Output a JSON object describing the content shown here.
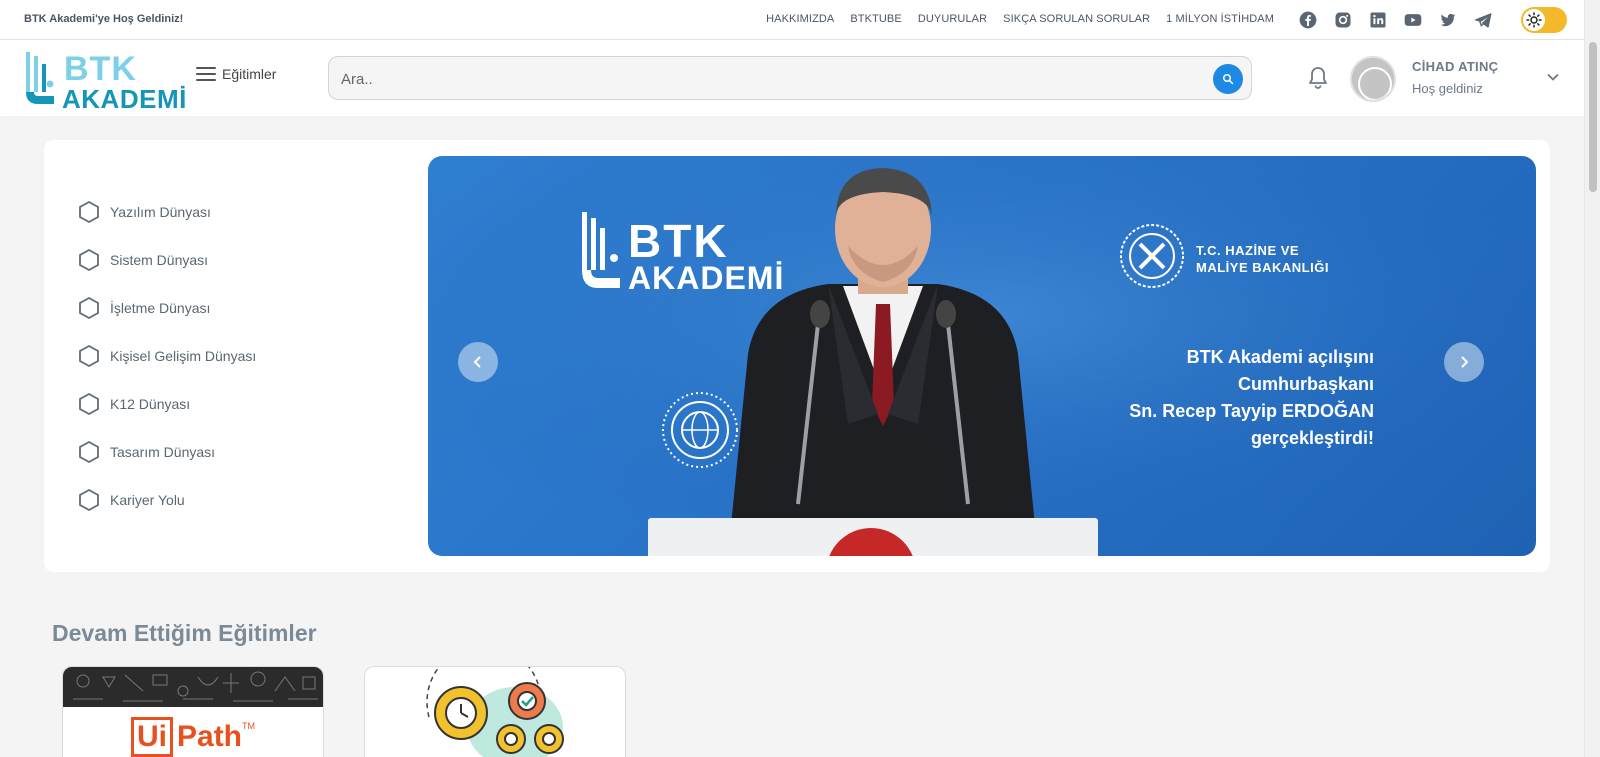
{
  "topbar": {
    "welcome": "BTK Akademi'ye Hoş Geldiniz!",
    "links": [
      "HAKKIMIZDA",
      "BTKTUBE",
      "DUYURULAR",
      "SIKÇA SORULAN SORULAR",
      "1 MİLYON İSTİHDAM"
    ],
    "socials": [
      "facebook-icon",
      "instagram-icon",
      "linkedin-icon",
      "youtube-icon",
      "twitter-icon",
      "telegram-icon"
    ],
    "theme_toggle": "sun-icon"
  },
  "header": {
    "logo_top": "BTK",
    "logo_bottom": "AKADEMİ",
    "menu_label": "Eğitimler",
    "search_placeholder": "Ara..",
    "user_name": "CİHAD ATINÇ",
    "user_greeting": "Hoş geldiniz"
  },
  "categories": [
    "Yazılım Dünyası",
    "Sistem Dünyası",
    "İşletme Dünyası",
    "Kişisel Gelişim Dünyası",
    "K12 Dünyası",
    "Tasarım Dünyası",
    "Kariyer Yolu"
  ],
  "slide": {
    "logo_top": "BTK",
    "logo_bottom": "AKADEMİ",
    "ministry_line1": "T.C. HAZİNE VE",
    "ministry_line2": "MALİYE BAKANLIĞI",
    "text_line1": "BTK Akademi açılışını",
    "text_line2": "Cumhurbaşkanı",
    "text_line3": "Sn. Recep Tayyip ERDOĞAN",
    "text_line4": "gerçekleştirdi!"
  },
  "continuing": {
    "title": "Devam Ettiğim Eğitimler",
    "courses": [
      {
        "logo_text_boxed": "Ui",
        "logo_text": "Path",
        "logo_tm": "TM"
      },
      {
        "icon": "gears-icon"
      }
    ]
  },
  "colors": {
    "accent": "#1e88e5",
    "brand_light": "#7ed0e8",
    "brand_dark": "#1596b7",
    "toggle": "#f4b92b",
    "slider_blue": "#2873c8",
    "uipath_orange": "#e8501f"
  }
}
